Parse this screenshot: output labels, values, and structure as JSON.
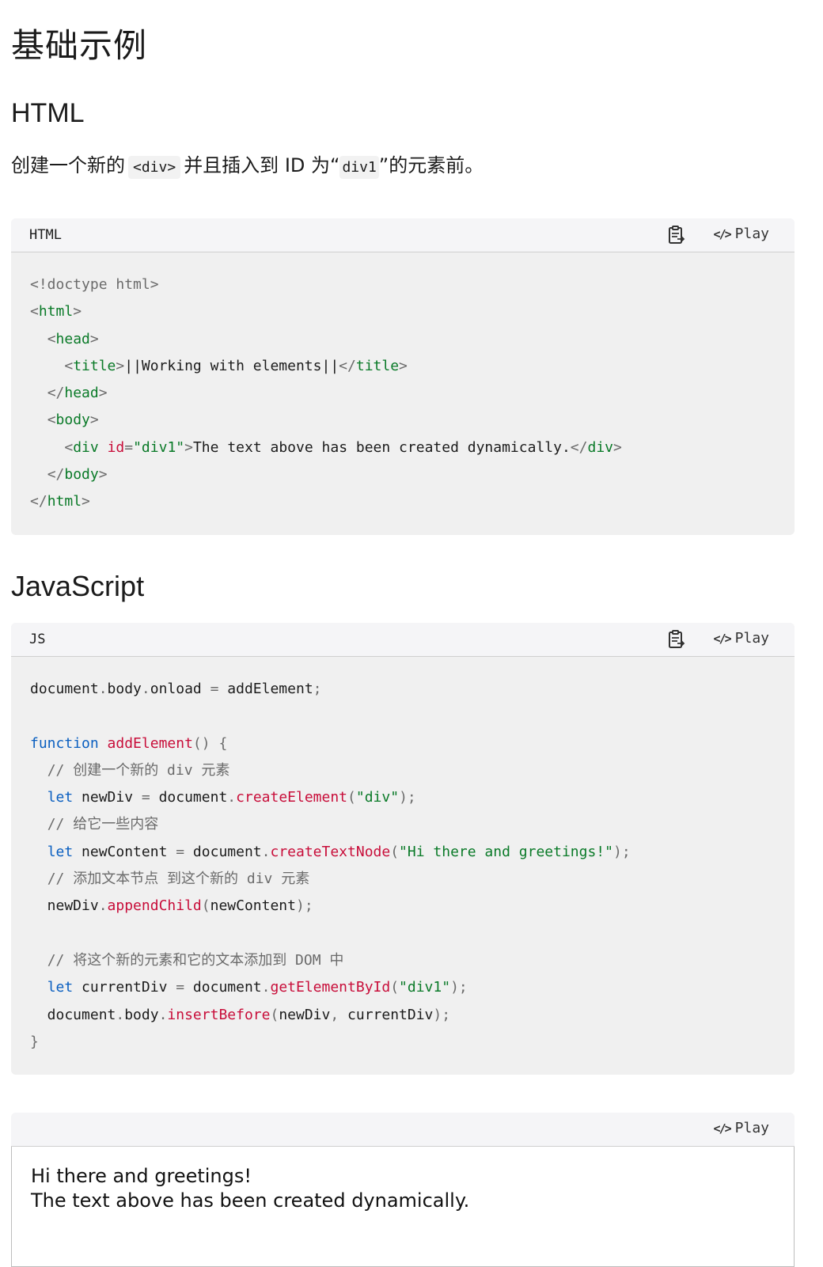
{
  "page": {
    "heading": "基础示例",
    "html_heading": "HTML",
    "intro": {
      "part1": "创建一个新的",
      "code1": "<div>",
      "part2": "并且插入到 ID 为“",
      "code2": "div1",
      "part3": "”的元素前。"
    },
    "js_heading": "JavaScript"
  },
  "html_block": {
    "lang": "HTML",
    "play_label": "Play",
    "copy_icon": "clipboard-icon",
    "play_icon": "code-icon"
  },
  "js_block": {
    "lang": "JS",
    "play_label": "Play",
    "copy_icon": "clipboard-icon",
    "play_icon": "code-icon"
  },
  "result_block": {
    "play_label": "Play",
    "play_icon": "code-icon",
    "line1": "Hi there and greetings!",
    "line2": "The text above has been created dynamically."
  }
}
